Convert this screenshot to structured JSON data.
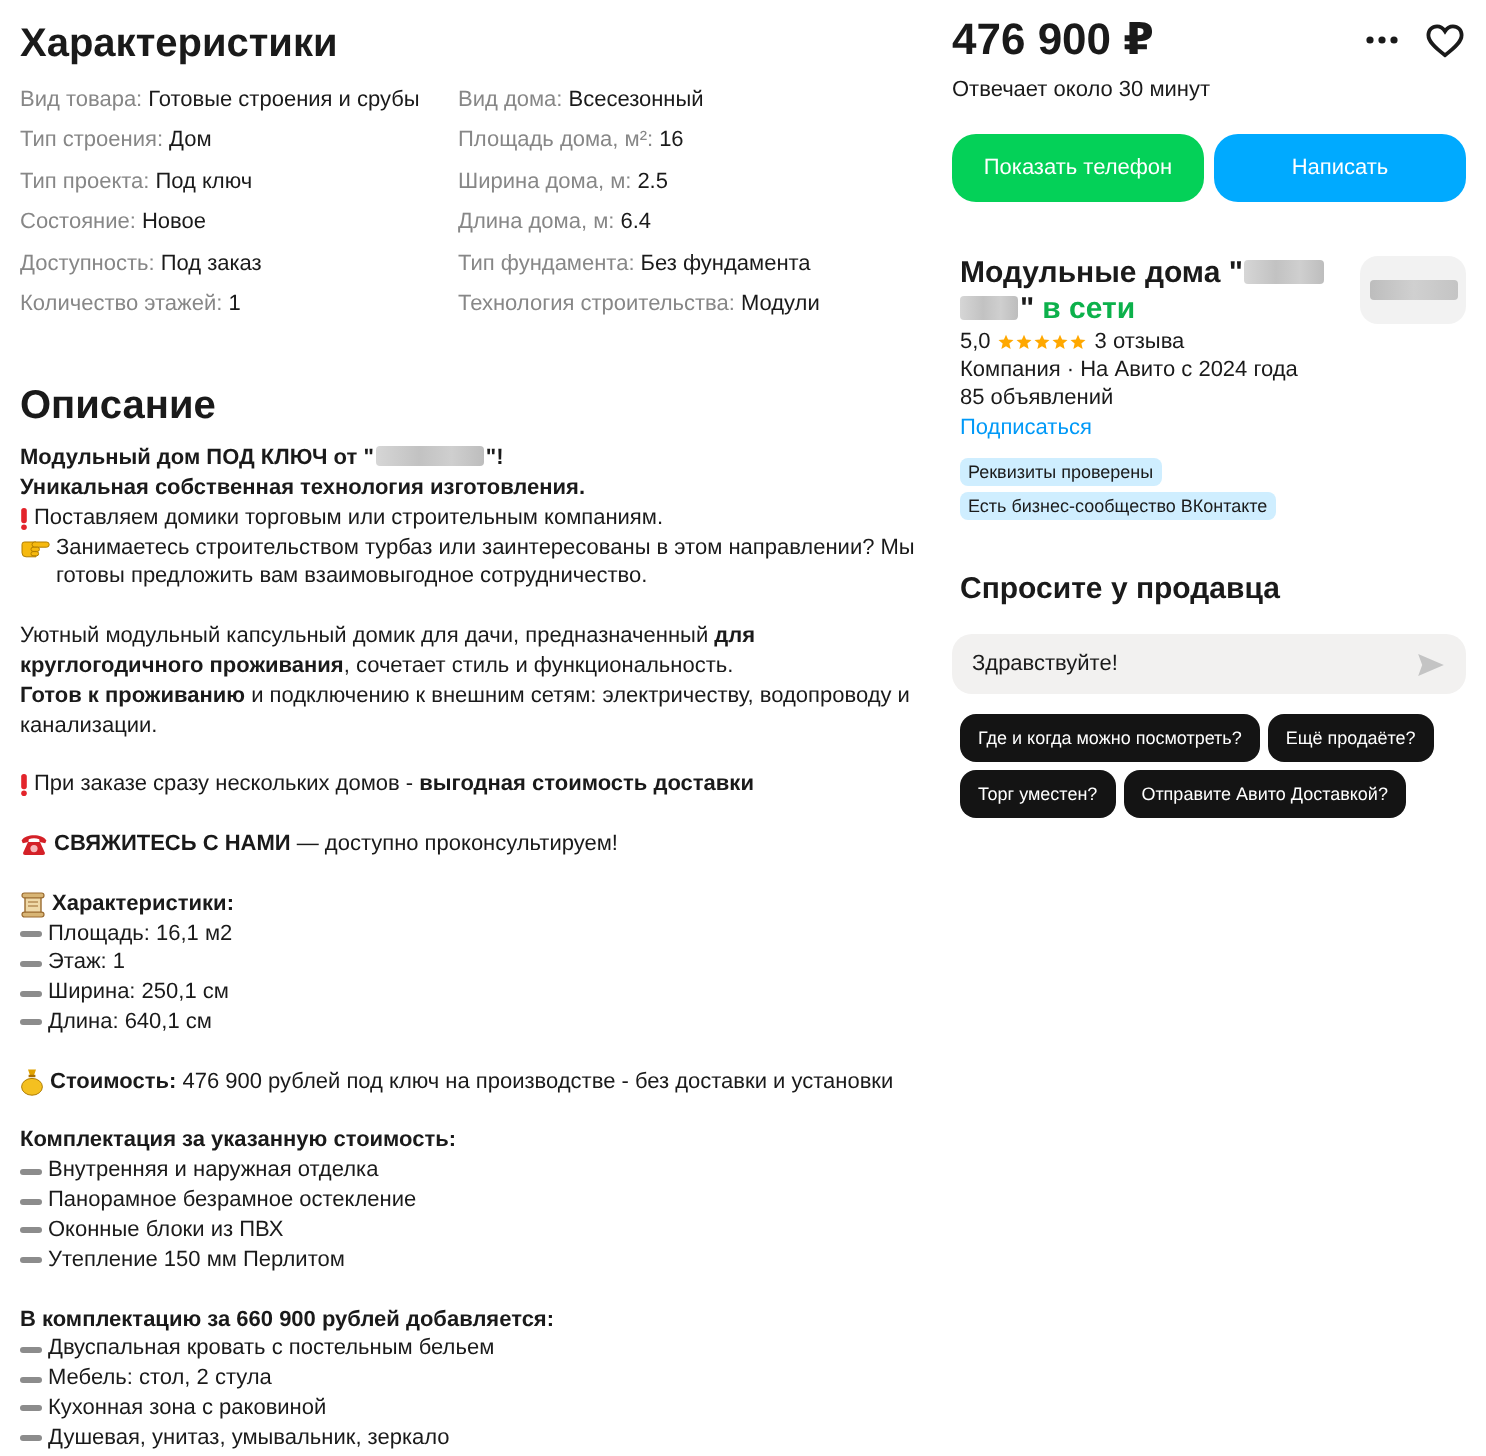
{
  "specs": {
    "title": "Характеристики",
    "columns": [
      [
        {
          "label": "Вид товара:",
          "value": "Готовые строения и срубы"
        },
        {
          "label": "Тип строения:",
          "value": "Дом"
        },
        {
          "label": "Тип проекта:",
          "value": "Под ключ"
        },
        {
          "label": "Состояние:",
          "value": "Новое"
        },
        {
          "label": "Доступность:",
          "value": "Под заказ"
        },
        {
          "label": "Количество этажей:",
          "value": "1"
        }
      ],
      [
        {
          "label": "Вид дома:",
          "value": "Всесезонный"
        },
        {
          "label": "Площадь дома, м²:",
          "value": "16"
        },
        {
          "label": "Ширина дома, м:",
          "value": "2.5"
        },
        {
          "label": "Длина дома, м:",
          "value": "6.4"
        },
        {
          "label": "Тип фундамента:",
          "value": "Без фундамента"
        },
        {
          "label": "Технология строительства:",
          "value": "Модули"
        }
      ]
    ]
  },
  "description": {
    "title": "Описание",
    "blocks": [
      [
        {
          "kind": "masked",
          "text": "Модульный дом ПОД КЛЮЧ от \"",
          "tail": "\"!"
        },
        {
          "kind": "bold",
          "text": "Уникальная собственная технология изготовления."
        },
        {
          "kind": "alert",
          "text": "Поставляем домики торговым или строительным компаниям."
        },
        {
          "kind": "hand",
          "text": "Занимаетесь строительством турбаз или заинтересованы в этом направлении? Мы готовы предложить вам взаимовыгодное сотрудничество."
        }
      ],
      [
        {
          "kind": "text",
          "text": "Уютный модульный капсульный домик для дачи, предназначенный **для круглогодичного проживания**, сочетает стиль и функциональность."
        },
        {
          "kind": "text",
          "text": "**Готов к проживанию** и подключению к внешним сетям: электричеству, водопроводу и канализации."
        }
      ],
      [
        {
          "kind": "alert",
          "text": "При заказе сразу нескольких домов - **выгодная стоимость доставки**"
        }
      ],
      [
        {
          "kind": "phone",
          "text": "**СВЯЖИТЕСЬ С НАМИ** — доступно проконсультируем!"
        }
      ],
      [
        {
          "kind": "scroll",
          "text": "Характеристики:"
        },
        {
          "kind": "dash",
          "text": "Площадь: 16,1 м2"
        },
        {
          "kind": "dash",
          "text": "Этаж: 1"
        },
        {
          "kind": "dash",
          "text": "Ширина: 250,1 см"
        },
        {
          "kind": "dash",
          "text": "Длина: 640,1 см"
        }
      ],
      [
        {
          "kind": "bag",
          "text": "**Стоимость:** 476 900 рублей под ключ на производстве - без доставки и установки"
        }
      ],
      [
        {
          "kind": "bold",
          "text": "Комплектация за указанную стоимость:"
        },
        {
          "kind": "dash",
          "text": "Внутренняя и наружная отделка"
        },
        {
          "kind": "dash",
          "text": "Панорамное безрамное остекление"
        },
        {
          "kind": "dash",
          "text": "Оконные блоки из ПВХ"
        },
        {
          "kind": "dash",
          "text": "Утепление 150 мм Перлитом"
        }
      ],
      [
        {
          "kind": "bold",
          "text": "В комплектацию за 660 900 рублей добавляется:"
        },
        {
          "kind": "dash",
          "text": "Двуспальная кровать с постельным бельем"
        },
        {
          "kind": "dash",
          "text": "Мебель: стол, 2 стула"
        },
        {
          "kind": "dash",
          "text": "Кухонная зона с раковиной"
        },
        {
          "kind": "dash",
          "text": "Душевая, унитаз, умывальник, зеркало"
        }
      ]
    ]
  },
  "offer": {
    "price": "476 900 ₽",
    "response_time": "Отвечает около 30 минут",
    "buttons": [
      {
        "kind": "call",
        "label": "Показать телефон"
      },
      {
        "kind": "message",
        "label": "Написать"
      }
    ]
  },
  "seller": {
    "name_start": "Модульные дома \"",
    "name_end": "\"",
    "online": "в сети",
    "rating": "5,0",
    "stars": 5,
    "reviews": "3 отзыва",
    "info": "Компания · На Авито с 2024 года",
    "listings": "85 объявлений",
    "subscribe": "Подписаться",
    "badges": [
      "Реквизиты проверены",
      "Есть бизнес-сообщество ВКонтакте"
    ]
  },
  "ask": {
    "title": "Спросите у продавца",
    "message": "Здравствуйте!",
    "suggestions": [
      "Где и когда можно посмотреть?",
      "Ещё продаёте?",
      "Торг уместен?",
      "Отправите Авито Доставкой?"
    ]
  }
}
